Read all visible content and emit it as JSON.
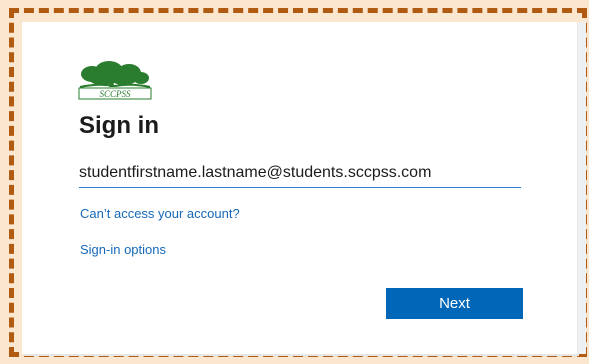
{
  "logo": {
    "text": "SCCPSS",
    "tree_color": "#2a7c2e"
  },
  "signin": {
    "title": "Sign in",
    "email_value": "studentfirstname.lastname@students.sccpss.com",
    "cant_access_link": "Can’t access your account?",
    "options_link": "Sign-in options",
    "next_button": "Next"
  },
  "colors": {
    "background": "#fbe6cf",
    "border": "#b15a12",
    "accent": "#0067b8",
    "link": "#1569b8"
  }
}
